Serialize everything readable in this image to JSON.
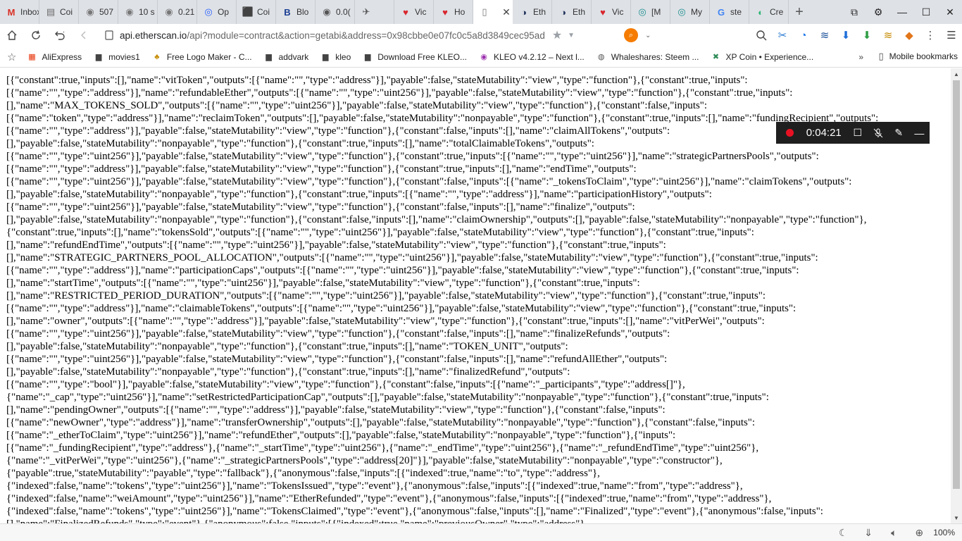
{
  "tabs": [
    {
      "title": "Inbox",
      "favicon": "M",
      "color": "#d93025"
    },
    {
      "title": "Coi",
      "favicon": "▤",
      "color": "#6b6b6b"
    },
    {
      "title": "507",
      "favicon": "◉",
      "color": "#777"
    },
    {
      "title": "10 s",
      "favicon": "◉",
      "color": "#777"
    },
    {
      "title": "0.21",
      "favicon": "◉",
      "color": "#777"
    },
    {
      "title": "Op",
      "favicon": "◎",
      "color": "#2962ff"
    },
    {
      "title": "Coi",
      "favicon": "⬛",
      "color": "#c29a00"
    },
    {
      "title": "Blo",
      "favicon": "B",
      "color": "#1c3f94"
    },
    {
      "title": "0.0(",
      "favicon": "◉",
      "color": "#555"
    },
    {
      "title": "",
      "favicon": "✈",
      "color": "#555"
    },
    {
      "title": "Vic",
      "favicon": "♥",
      "color": "#d8262e"
    },
    {
      "title": "Ho",
      "favicon": "♥",
      "color": "#d8262e"
    },
    {
      "title": "",
      "favicon": "▯",
      "color": "#777",
      "active": true
    },
    {
      "title": "Eth",
      "favicon": "◑",
      "color": "#21325b"
    },
    {
      "title": "Eth",
      "favicon": "◑",
      "color": "#21325b"
    },
    {
      "title": "Vic",
      "favicon": "♥",
      "color": "#d8262e"
    },
    {
      "title": "[M",
      "favicon": "◎",
      "color": "#1a8f8f"
    },
    {
      "title": "My",
      "favicon": "◎",
      "color": "#1a8f8f"
    },
    {
      "title": "ste",
      "favicon": "G",
      "color": "#4285f4"
    },
    {
      "title": "Cre",
      "favicon": "◐",
      "color": "#2bb673"
    }
  ],
  "tab_close": "✕",
  "new_tab": "+",
  "window": {
    "minimize": "—",
    "maximize": "☐",
    "close": "✕"
  },
  "address": {
    "url_host": "api.etherscan.io",
    "url_path": "/api?module=contract&action=getabi&address=0x98cbbe0e07fc0c5a8d3849cec95ad"
  },
  "toolbar_icons": [
    "search-icon",
    "scissors-icon",
    "check-icon",
    "steem-icon",
    "download-icon",
    "extension-icon",
    "whaleshares-icon",
    "metamask-icon",
    "menu-icon",
    "hamburger-icon"
  ],
  "bookmarks": [
    {
      "label": "AliExpress",
      "icon": "▦",
      "color": "#e62e04"
    },
    {
      "label": "movies1",
      "icon": "▆",
      "color": "#444"
    },
    {
      "label": "Free Logo Maker - C...",
      "icon": "♣",
      "color": "#c48a00"
    },
    {
      "label": "addvark",
      "icon": "▆",
      "color": "#444"
    },
    {
      "label": "kleo",
      "icon": "▆",
      "color": "#444"
    },
    {
      "label": "Download Free KLEO...",
      "icon": "▆",
      "color": "#444"
    },
    {
      "label": "KLEO v4.2.12 – Next l...",
      "icon": "◉",
      "color": "#9b2fae"
    },
    {
      "label": "Whaleshares: Steem ...",
      "icon": "◍",
      "color": "#555"
    },
    {
      "label": "XP Coin • Experience...",
      "icon": "✖",
      "color": "#2e8b57"
    }
  ],
  "bookmarks_more": "»",
  "mobile_bookmarks": "Mobile bookmarks",
  "json_lines": [
    "[{\"constant\":true,\"inputs\":[],\"name\":\"vitToken\",\"outputs\":[{\"name\":\"\",\"type\":\"address\"}],\"payable\":false,\"stateMutability\":\"view\",\"type\":\"function\"},{\"constant\":true,\"inputs\":",
    "[{\"name\":\"\",\"type\":\"address\"}],\"name\":\"refundableEther\",\"outputs\":[{\"name\":\"\",\"type\":\"uint256\"}],\"payable\":false,\"stateMutability\":\"view\",\"type\":\"function\"},{\"constant\":true,\"inputs\":",
    "[],\"name\":\"MAX_TOKENS_SOLD\",\"outputs\":[{\"name\":\"\",\"type\":\"uint256\"}],\"payable\":false,\"stateMutability\":\"view\",\"type\":\"function\"},{\"constant\":false,\"inputs\":",
    "[{\"name\":\"token\",\"type\":\"address\"}],\"name\":\"reclaimToken\",\"outputs\":[],\"payable\":false,\"stateMutability\":\"nonpayable\",\"type\":\"function\"},{\"constant\":true,\"inputs\":[],\"name\":\"fundingRecipient\",\"outputs\":",
    "[{\"name\":\"\",\"type\":\"address\"}],\"payable\":false,\"stateMutability\":\"view\",\"type\":\"function\"},{\"constant\":false,\"inputs\":[],\"name\":\"claimAllTokens\",\"outputs\":",
    "[],\"payable\":false,\"stateMutability\":\"nonpayable\",\"type\":\"function\"},{\"constant\":true,\"inputs\":[],\"name\":\"totalClaimableTokens\",\"outputs\":",
    "[{\"name\":\"\",\"type\":\"uint256\"}],\"payable\":false,\"stateMutability\":\"view\",\"type\":\"function\"},{\"constant\":true,\"inputs\":[{\"name\":\"\",\"type\":\"uint256\"}],\"name\":\"strategicPartnersPools\",\"outputs\":",
    "[{\"name\":\"\",\"type\":\"address\"}],\"payable\":false,\"stateMutability\":\"view\",\"type\":\"function\"},{\"constant\":true,\"inputs\":[],\"name\":\"endTime\",\"outputs\":",
    "[{\"name\":\"\",\"type\":\"uint256\"}],\"payable\":false,\"stateMutability\":\"view\",\"type\":\"function\"},{\"constant\":false,\"inputs\":[{\"name\":\"_tokensToClaim\",\"type\":\"uint256\"}],\"name\":\"claimTokens\",\"outputs\":",
    "[],\"payable\":false,\"stateMutability\":\"nonpayable\",\"type\":\"function\"},{\"constant\":true,\"inputs\":[{\"name\":\"\",\"type\":\"address\"}],\"name\":\"participationHistory\",\"outputs\":",
    "[{\"name\":\"\",\"type\":\"uint256\"}],\"payable\":false,\"stateMutability\":\"view\",\"type\":\"function\"},{\"constant\":false,\"inputs\":[],\"name\":\"finalize\",\"outputs\":",
    "[],\"payable\":false,\"stateMutability\":\"nonpayable\",\"type\":\"function\"},{\"constant\":false,\"inputs\":[],\"name\":\"claimOwnership\",\"outputs\":[],\"payable\":false,\"stateMutability\":\"nonpayable\",\"type\":\"function\"},",
    "{\"constant\":true,\"inputs\":[],\"name\":\"tokensSold\",\"outputs\":[{\"name\":\"\",\"type\":\"uint256\"}],\"payable\":false,\"stateMutability\":\"view\",\"type\":\"function\"},{\"constant\":true,\"inputs\":",
    "[],\"name\":\"refundEndTime\",\"outputs\":[{\"name\":\"\",\"type\":\"uint256\"}],\"payable\":false,\"stateMutability\":\"view\",\"type\":\"function\"},{\"constant\":true,\"inputs\":",
    "[],\"name\":\"STRATEGIC_PARTNERS_POOL_ALLOCATION\",\"outputs\":[{\"name\":\"\",\"type\":\"uint256\"}],\"payable\":false,\"stateMutability\":\"view\",\"type\":\"function\"},{\"constant\":true,\"inputs\":",
    "[{\"name\":\"\",\"type\":\"address\"}],\"name\":\"participationCaps\",\"outputs\":[{\"name\":\"\",\"type\":\"uint256\"}],\"payable\":false,\"stateMutability\":\"view\",\"type\":\"function\"},{\"constant\":true,\"inputs\":",
    "[],\"name\":\"startTime\",\"outputs\":[{\"name\":\"\",\"type\":\"uint256\"}],\"payable\":false,\"stateMutability\":\"view\",\"type\":\"function\"},{\"constant\":true,\"inputs\":",
    "[],\"name\":\"RESTRICTED_PERIOD_DURATION\",\"outputs\":[{\"name\":\"\",\"type\":\"uint256\"}],\"payable\":false,\"stateMutability\":\"view\",\"type\":\"function\"},{\"constant\":true,\"inputs\":",
    "[{\"name\":\"\",\"type\":\"address\"}],\"name\":\"claimableTokens\",\"outputs\":[{\"name\":\"\",\"type\":\"uint256\"}],\"payable\":false,\"stateMutability\":\"view\",\"type\":\"function\"},{\"constant\":true,\"inputs\":",
    "[],\"name\":\"owner\",\"outputs\":[{\"name\":\"\",\"type\":\"address\"}],\"payable\":false,\"stateMutability\":\"view\",\"type\":\"function\"},{\"constant\":true,\"inputs\":[],\"name\":\"vitPerWei\",\"outputs\":",
    "[{\"name\":\"\",\"type\":\"uint256\"}],\"payable\":false,\"stateMutability\":\"view\",\"type\":\"function\"},{\"constant\":false,\"inputs\":[],\"name\":\"finalizeRefunds\",\"outputs\":",
    "[],\"payable\":false,\"stateMutability\":\"nonpayable\",\"type\":\"function\"},{\"constant\":true,\"inputs\":[],\"name\":\"TOKEN_UNIT\",\"outputs\":",
    "[{\"name\":\"\",\"type\":\"uint256\"}],\"payable\":false,\"stateMutability\":\"view\",\"type\":\"function\"},{\"constant\":false,\"inputs\":[],\"name\":\"refundAllEther\",\"outputs\":",
    "[],\"payable\":false,\"stateMutability\":\"nonpayable\",\"type\":\"function\"},{\"constant\":true,\"inputs\":[],\"name\":\"finalizedRefund\",\"outputs\":",
    "[{\"name\":\"\",\"type\":\"bool\"}],\"payable\":false,\"stateMutability\":\"view\",\"type\":\"function\"},{\"constant\":false,\"inputs\":[{\"name\":\"_participants\",\"type\":\"address[]\"},",
    "{\"name\":\"_cap\",\"type\":\"uint256\"}],\"name\":\"setRestrictedParticipationCap\",\"outputs\":[],\"payable\":false,\"stateMutability\":\"nonpayable\",\"type\":\"function\"},{\"constant\":true,\"inputs\":",
    "[],\"name\":\"pendingOwner\",\"outputs\":[{\"name\":\"\",\"type\":\"address\"}],\"payable\":false,\"stateMutability\":\"view\",\"type\":\"function\"},{\"constant\":false,\"inputs\":",
    "[{\"name\":\"newOwner\",\"type\":\"address\"}],\"name\":\"transferOwnership\",\"outputs\":[],\"payable\":false,\"stateMutability\":\"nonpayable\",\"type\":\"function\"},{\"constant\":false,\"inputs\":",
    "[{\"name\":\"_etherToClaim\",\"type\":\"uint256\"}],\"name\":\"refundEther\",\"outputs\":[],\"payable\":false,\"stateMutability\":\"nonpayable\",\"type\":\"function\"},{\"inputs\":",
    "[{\"name\":\"_fundingRecipient\",\"type\":\"address\"},{\"name\":\"_startTime\",\"type\":\"uint256\"},{\"name\":\"_endTime\",\"type\":\"uint256\"},{\"name\":\"_refundEndTime\",\"type\":\"uint256\"},",
    "{\"name\":\"_vitPerWei\",\"type\":\"uint256\"},{\"name\":\"_strategicPartnersPools\",\"type\":\"address[20]\"}],\"payable\":false,\"stateMutability\":\"nonpayable\",\"type\":\"constructor\"},",
    "{\"payable\":true,\"stateMutability\":\"payable\",\"type\":\"fallback\"},{\"anonymous\":false,\"inputs\":[{\"indexed\":true,\"name\":\"to\",\"type\":\"address\"},",
    "{\"indexed\":false,\"name\":\"tokens\",\"type\":\"uint256\"}],\"name\":\"TokensIssued\",\"type\":\"event\"},{\"anonymous\":false,\"inputs\":[{\"indexed\":true,\"name\":\"from\",\"type\":\"address\"},",
    "{\"indexed\":false,\"name\":\"weiAmount\",\"type\":\"uint256\"}],\"name\":\"EtherRefunded\",\"type\":\"event\"},{\"anonymous\":false,\"inputs\":[{\"indexed\":true,\"name\":\"from\",\"type\":\"address\"},",
    "{\"indexed\":false,\"name\":\"tokens\",\"type\":\"uint256\"}],\"name\":\"TokensClaimed\",\"type\":\"event\"},{\"anonymous\":false,\"inputs\":[],\"name\":\"Finalized\",\"type\":\"event\"},{\"anonymous\":false,\"inputs\":",
    "[],\"name\":\"FinalizedRefunds\",\"type\":\"event\"},{\"anonymous\":false,\"inputs\":[{\"indexed\":true,\"name\":\"previousOwner\",\"type\":\"address\"},"
  ],
  "recorder": {
    "time": "0:04:21"
  },
  "status": {
    "zoom": "100%"
  }
}
